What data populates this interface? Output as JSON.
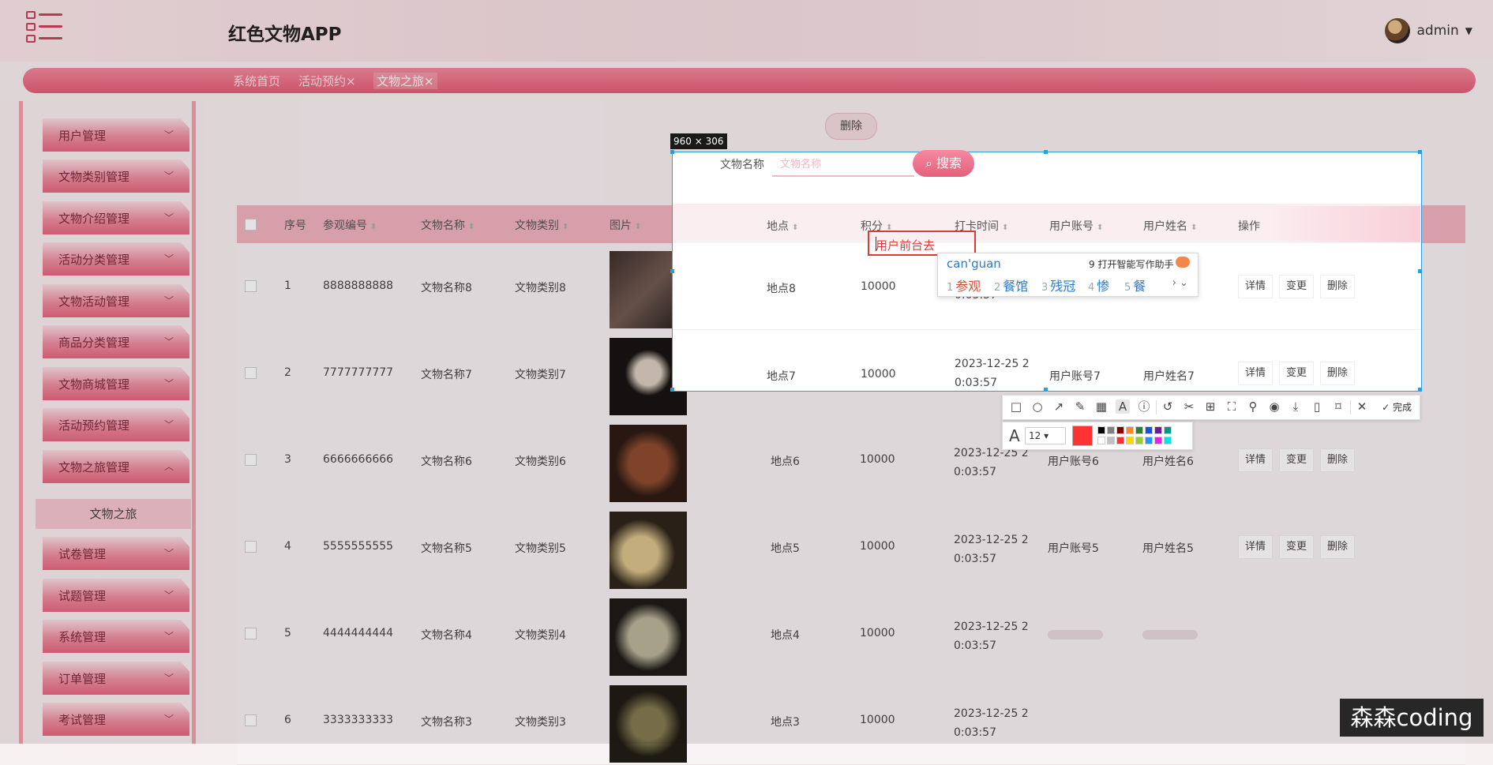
{
  "header": {
    "title": "红色文物APP",
    "user": "admin"
  },
  "tabs": [
    "系统首页",
    "活动预约×",
    "文物之旅×"
  ],
  "sidebar": {
    "items": [
      "用户管理",
      "文物类别管理",
      "文物介绍管理",
      "活动分类管理",
      "文物活动管理",
      "商品分类管理",
      "文物商城管理",
      "活动预约管理",
      "文物之旅管理",
      "试卷管理",
      "试题管理",
      "系统管理",
      "订单管理",
      "考试管理"
    ],
    "active_sub": "文物之旅"
  },
  "toolbar": {
    "delete_label": "删除"
  },
  "search": {
    "label": "文物名称",
    "placeholder": "文物名称",
    "button": "搜索"
  },
  "table": {
    "headers": [
      "序号",
      "参观编号",
      "文物名称",
      "文物类别",
      "图片",
      "地点",
      "积分",
      "打卡时间",
      "用户账号",
      "用户姓名",
      "操作"
    ],
    "rows": [
      {
        "no": "1",
        "code": "8888888888",
        "name": "文物名称8",
        "type": "文物类别8",
        "place": "地点8",
        "points": "10000",
        "t1": "",
        "t2": "0:03:57",
        "account": "",
        "username": ""
      },
      {
        "no": "2",
        "code": "7777777777",
        "name": "文物名称7",
        "type": "文物类别7",
        "place": "地点7",
        "points": "10000",
        "t1": "2023-12-25 2",
        "t2": "0:03:57",
        "account": "用户账号7",
        "username": "用户姓名7"
      },
      {
        "no": "3",
        "code": "6666666666",
        "name": "文物名称6",
        "type": "文物类别6",
        "place": "地点6",
        "points": "10000",
        "t1": "2023-12-25 2",
        "t2": "0:03:57",
        "account": "用户账号6",
        "username": "用户姓名6"
      },
      {
        "no": "4",
        "code": "5555555555",
        "name": "文物名称5",
        "type": "文物类别5",
        "place": "地点5",
        "points": "10000",
        "t1": "2023-12-25 2",
        "t2": "0:03:57",
        "account": "用户账号5",
        "username": "用户姓名5"
      },
      {
        "no": "5",
        "code": "4444444444",
        "name": "文物名称4",
        "type": "文物类别4",
        "place": "地点4",
        "points": "10000",
        "t1": "2023-12-25 2",
        "t2": "0:03:57",
        "account": "",
        "username": ""
      },
      {
        "no": "6",
        "code": "3333333333",
        "name": "文物名称3",
        "type": "文物类别3",
        "place": "地点3",
        "points": "10000",
        "t1": "2023-12-25 2",
        "t2": "0:03:57",
        "account": "",
        "username": ""
      }
    ],
    "ops": [
      "详情",
      "变更",
      "删除"
    ]
  },
  "capture": {
    "size_label": "960 × 306",
    "text": "用户前台去",
    "ime": {
      "composition": "can'guan",
      "assistant": "9 打开智能写作助手",
      "candidates": [
        "参观",
        "餐馆",
        "残冠",
        "惨",
        "餐"
      ],
      "numbers": [
        "1",
        "2",
        "3",
        "4",
        "5"
      ],
      "arrows": "› ⌄"
    },
    "done_label": "完成",
    "font_size": "12",
    "current_color": "#ff3333",
    "palette": [
      "#000000",
      "#808080",
      "#800000",
      "#f08a30",
      "#2e7d32",
      "#1e4fd8",
      "#6a1b9a",
      "#009688",
      "#ffffff",
      "#c0c0c0",
      "#ff3030",
      "#ffd600",
      "#9ccc33",
      "#2196f3",
      "#e91ee0",
      "#00e5e5"
    ]
  },
  "watermark": "森森coding"
}
